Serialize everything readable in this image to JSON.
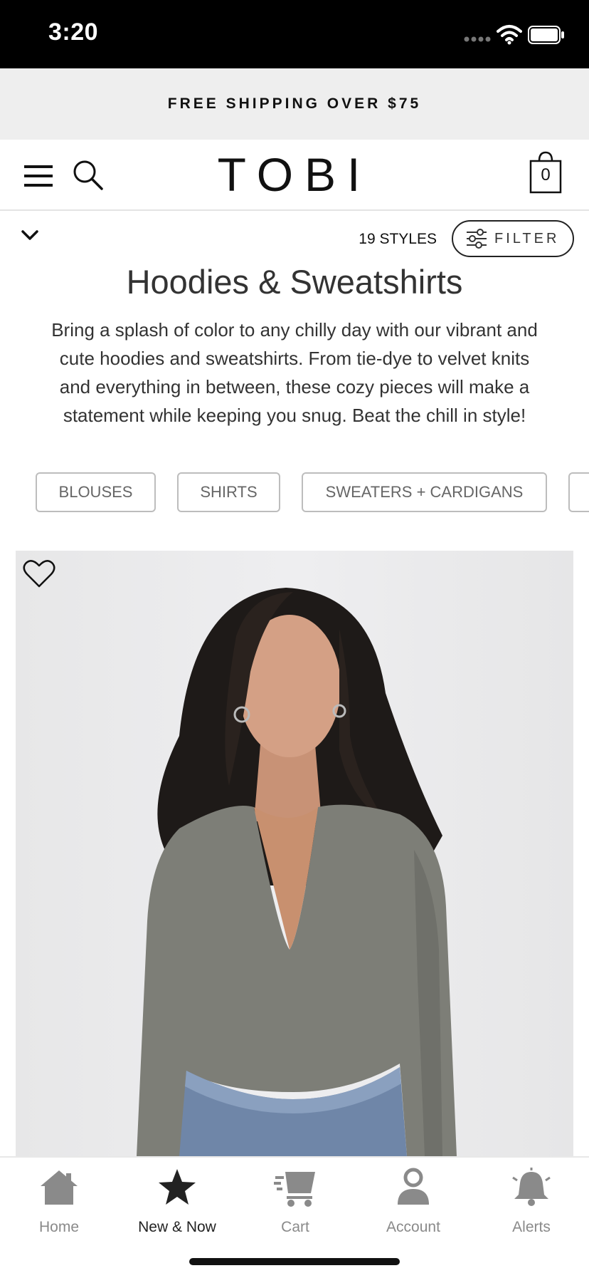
{
  "status_bar": {
    "time": "3:20"
  },
  "promo": {
    "text": "FREE SHIPPING OVER $75"
  },
  "header": {
    "logo": "TOBI",
    "cart_count": "0"
  },
  "toolbar": {
    "style_count": "19 STYLES",
    "filter_label": "FILTER"
  },
  "category": {
    "title": "Hoodies & Sweatshirts",
    "description": "Bring a splash of color to any chilly day with our vibrant and cute hoodies and sweatshirts. From tie-dye to velvet knits and everything in between, these cozy pieces will make a statement while keeping you snug. Beat the chill in style!"
  },
  "chips": [
    "BLOUSES",
    "SHIRTS",
    "SWEATERS + CARDIGANS"
  ],
  "tabs": [
    {
      "label": "Home",
      "icon": "home-icon"
    },
    {
      "label": "New & Now",
      "icon": "star-icon",
      "active": true
    },
    {
      "label": "Cart",
      "icon": "cart-icon"
    },
    {
      "label": "Account",
      "icon": "account-icon"
    },
    {
      "label": "Alerts",
      "icon": "bell-icon"
    }
  ],
  "colors": {
    "active_tab": "#222222",
    "inactive_tab": "#8a8a8a",
    "promo_bg": "#eeeeee"
  }
}
